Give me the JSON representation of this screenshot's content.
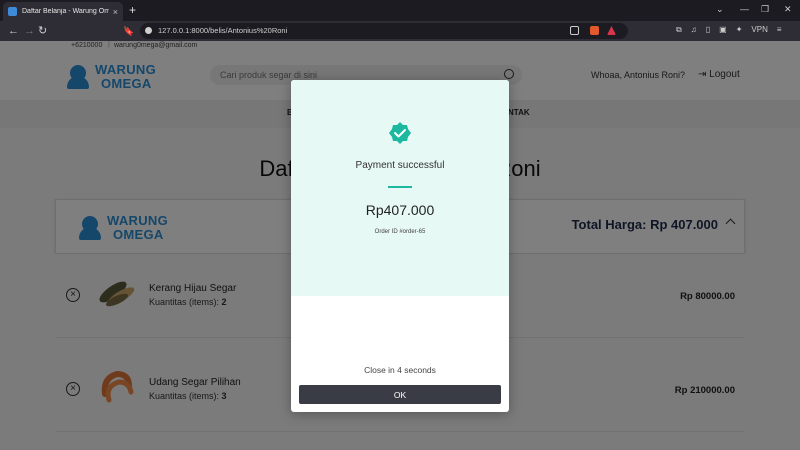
{
  "browser": {
    "tab_title": "Daftar Belanja - Warung Omeg",
    "tab_close": "×",
    "new_tab": "+",
    "url": "127.0.0.1:8000/belis/Antonius%20Roni",
    "vpn_label": "VPN",
    "back": "←",
    "forward": "→",
    "reload": "↻"
  },
  "topstrip": {
    "phone": "+6210000",
    "email": "warung0mega@gmail.com"
  },
  "header": {
    "brand_line1": "WARUNG",
    "brand_line2": "OMEGA",
    "search_placeholder": "Cari produk segar di sini",
    "greeting": "Whoaa, Antonius Roni?",
    "logout": "Logout"
  },
  "nav": {
    "left_fragment": "B",
    "right_fragment": "NTAK"
  },
  "page": {
    "title": "Daftar Belanja Antonius Roni",
    "total_label": "Total Harga: Rp 407.000"
  },
  "items": [
    {
      "name": "Kerang Hijau Segar",
      "qty_label": "Kuantitas (items):",
      "qty": "2",
      "price": "Rp 80000.00",
      "remove": "×"
    },
    {
      "name": "Udang Segar Pilihan",
      "qty_label": "Kuantitas (items):",
      "qty": "3",
      "price": "Rp 210000.00",
      "remove": "×"
    }
  ],
  "modal": {
    "message": "Payment successful",
    "amount": "Rp407.000",
    "order_id": "Order ID #order-65",
    "close_in": "Close in 4 seconds",
    "ok": "OK"
  },
  "colors": {
    "brand": "#2b8fd6",
    "success": "#1cb9a0",
    "modal_top": "#e7f9f4",
    "ok_button": "#3a3c45"
  }
}
